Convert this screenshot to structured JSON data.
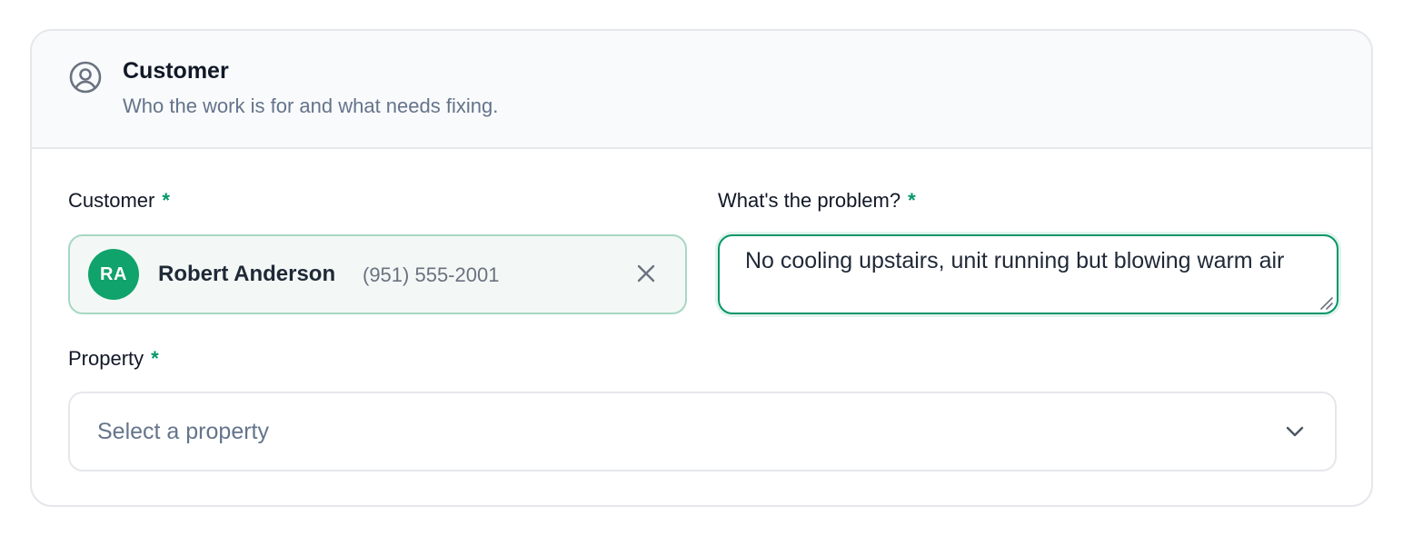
{
  "section": {
    "icon": "user-circle-icon",
    "title": "Customer",
    "subtitle": "Who the work is for and what needs fixing."
  },
  "customer_field": {
    "label": "Customer",
    "required_mark": "*",
    "selected": {
      "initials": "RA",
      "name": "Robert Anderson",
      "phone": "(951) 555-2001"
    },
    "clear_icon": "close-icon"
  },
  "problem_field": {
    "label": "What's the problem?",
    "required_mark": "*",
    "value": "No cooling upstairs, unit running but blowing warm air"
  },
  "property_field": {
    "label": "Property",
    "required_mark": "*",
    "placeholder": "Select a property",
    "icon": "chevron-down-icon"
  },
  "colors": {
    "accent": "#059669",
    "avatar_bg": "#10a36b",
    "chip_bg": "#f3f8f6",
    "chip_border": "#a7d7c2"
  }
}
